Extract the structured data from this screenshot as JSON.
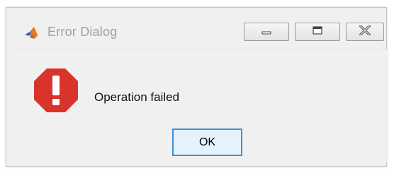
{
  "window": {
    "title": "Error Dialog",
    "app_icon": "matlab-logo-icon"
  },
  "titlebar_buttons": {
    "minimize_icon": "minimize-icon",
    "maximize_icon": "maximize-icon",
    "close_icon": "close-icon"
  },
  "dialog": {
    "icon": "error-stop-icon",
    "message": "Operation failed",
    "ok_label": "OK"
  },
  "colors": {
    "error_red": "#d9342b",
    "focus_blue": "#3c8fd9",
    "title_text": "#a0a0a0"
  }
}
